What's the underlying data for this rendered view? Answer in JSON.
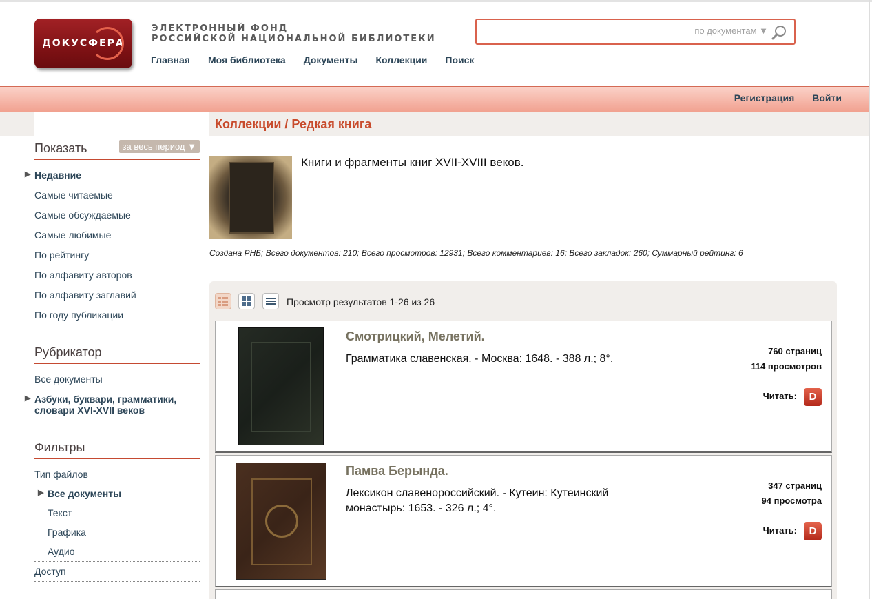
{
  "header": {
    "logo_text": "ДОКУСФЕРА",
    "site_title_line1": "ЭЛЕКТРОННЫЙ ФОНД",
    "site_title_line2": "РОССИЙСКОЙ НАЦИОНАЛЬНОЙ БИБЛИОТЕКИ",
    "nav": [
      "Главная",
      "Моя библиотека",
      "Документы",
      "Коллекции",
      "Поиск"
    ],
    "search": {
      "value": "",
      "scope": "по документам ▼"
    },
    "auth": [
      "Регистрация",
      "Войти"
    ]
  },
  "breadcrumb": "Коллекции / Редкая книга",
  "sidebar": {
    "show_title": "Показать",
    "period": "за весь период ▼",
    "show_items": [
      "Недавние",
      "Самые читаемые",
      "Самые обсуждаемые",
      "Самые любимые",
      "По рейтингу",
      "По алфавиту авторов",
      "По алфавиту заглавий",
      "По году публикации"
    ],
    "rubricator_title": "Рубрикатор",
    "rubricator_items": [
      "Все документы",
      "Азбуки, буквари, грамматики, словари XVI-XVII веков"
    ],
    "filters_title": "Фильтры",
    "file_type_label": "Тип файлов",
    "file_types": [
      "Все документы",
      "Текст",
      "Графика",
      "Аудио"
    ],
    "access_label": "Доступ"
  },
  "collection": {
    "description": "Книги и фрагменты книг XVII-XVIII веков.",
    "stats": "Создана РНБ; Всего документов: 210; Всего просмотров: 12931; Всего комментариев: 16; Всего закладок: 260; Суммарный рейтинг: 6"
  },
  "results": {
    "count_text": "Просмотр результатов 1-26 из 26",
    "items": [
      {
        "author": "Смотрицкий, Мелетий.",
        "description": "Грамматика славенская. - Москва: 1648. - 388 л.; 8°.",
        "pages": "760 страниц",
        "views": "114 просмотров",
        "read_label": "Читать:",
        "read_icon": "D"
      },
      {
        "author": "Памва Берында.",
        "description": "Лексикон славенороссийский. - Кутеин: Кутеинский монастырь: 1653. - 326 л.; 4°.",
        "pages": "347 страниц",
        "views": "94 просмотра",
        "read_label": "Читать:",
        "read_icon": "D"
      }
    ]
  },
  "colors": {
    "accent": "#c84b2c",
    "link": "#2d4658",
    "bar": "#f1a190"
  }
}
